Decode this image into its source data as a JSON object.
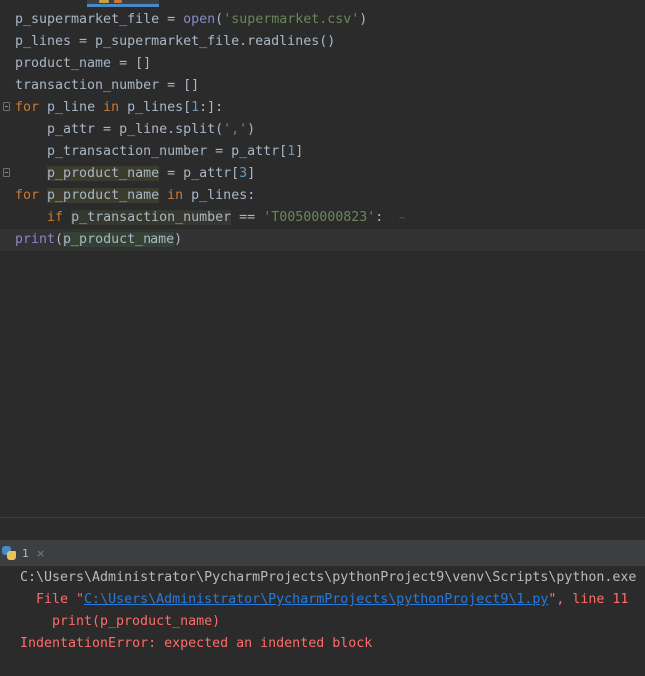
{
  "editor": {
    "tab": {
      "active_color": "#4a88c7"
    },
    "lines": [
      "p_supermarket_file = open('supermarket.csv')",
      "p_lines = p_supermarket_file.readlines()",
      "product_name = []",
      "transaction_number = []",
      "for p_line in p_lines[1:]:",
      "    p_attr = p_line.split(',')",
      "    p_transaction_number = p_attr[1]",
      "    p_product_name = p_attr[3]",
      "for p_product_name in p_lines:",
      "    if p_transaction_number == 'T00500000823':",
      "print(p_product_name)"
    ],
    "tokens": {
      "l1_var": "p_supermarket_file",
      "l1_eq": " = ",
      "l1_fn": "open",
      "l1_p1": "(",
      "l1_str": "'supermarket.csv'",
      "l1_p2": ")",
      "l2_text": "p_lines = p_supermarket_file.readlines()",
      "l3_text": "product_name = []",
      "l4_text": "transaction_number = []",
      "l5_for": "for",
      "l5_mid": " p_line ",
      "l5_in": "in",
      "l5_rest1": " p_lines[",
      "l5_num": "1",
      "l5_rest2": ":]:",
      "l6_pre": "    p_attr = p_line.split(",
      "l6_str": "','",
      "l6_post": ")",
      "l7_pre": "    p_transaction_number = p_attr[",
      "l7_num": "1",
      "l7_post": "]",
      "l8_indent": "    ",
      "l8_var": "p_product_name",
      "l8_mid": " = p_attr[",
      "l8_num": "3",
      "l8_post": "]",
      "l9_for": "for",
      "l9_sp": " ",
      "l9_var": "p_product_name",
      "l9_sp2": " ",
      "l9_in": "in",
      "l9_rest": " p_lines:",
      "l10_indent": "    ",
      "l10_if": "if",
      "l10_sp": " ",
      "l10_var": "p_transaction_number",
      "l10_eq": " == ",
      "l10_str": "'T00500000823'",
      "l10_colon": ":",
      "l11_print": "print",
      "l11_p1": "(",
      "l11_arg_a": "p_product_n",
      "l11_arg_b": "ame",
      "l11_p2": ")"
    },
    "error_marker": "~"
  },
  "run_panel": {
    "tab_label": "1",
    "close_glyph": "×",
    "icon": "python-icon",
    "console": {
      "path_line": "C:\\Users\\Administrator\\PycharmProjects\\pythonProject9\\venv\\Scripts\\python.exe",
      "file_prefix": "File \"",
      "file_link": "C:\\Users\\Administrator\\PycharmProjects\\pythonProject9\\1.py",
      "file_suffix": "\", line 11",
      "code_line": "print(p_product_name)",
      "error_line": "IndentationError: expected an indented block"
    }
  },
  "colors": {
    "background": "#2b2b2b",
    "keyword": "#cc7832",
    "string": "#6a8759",
    "number": "#6897bb",
    "builtin": "#8888c6",
    "error_text": "#ff6b68",
    "link": "#287bde"
  }
}
